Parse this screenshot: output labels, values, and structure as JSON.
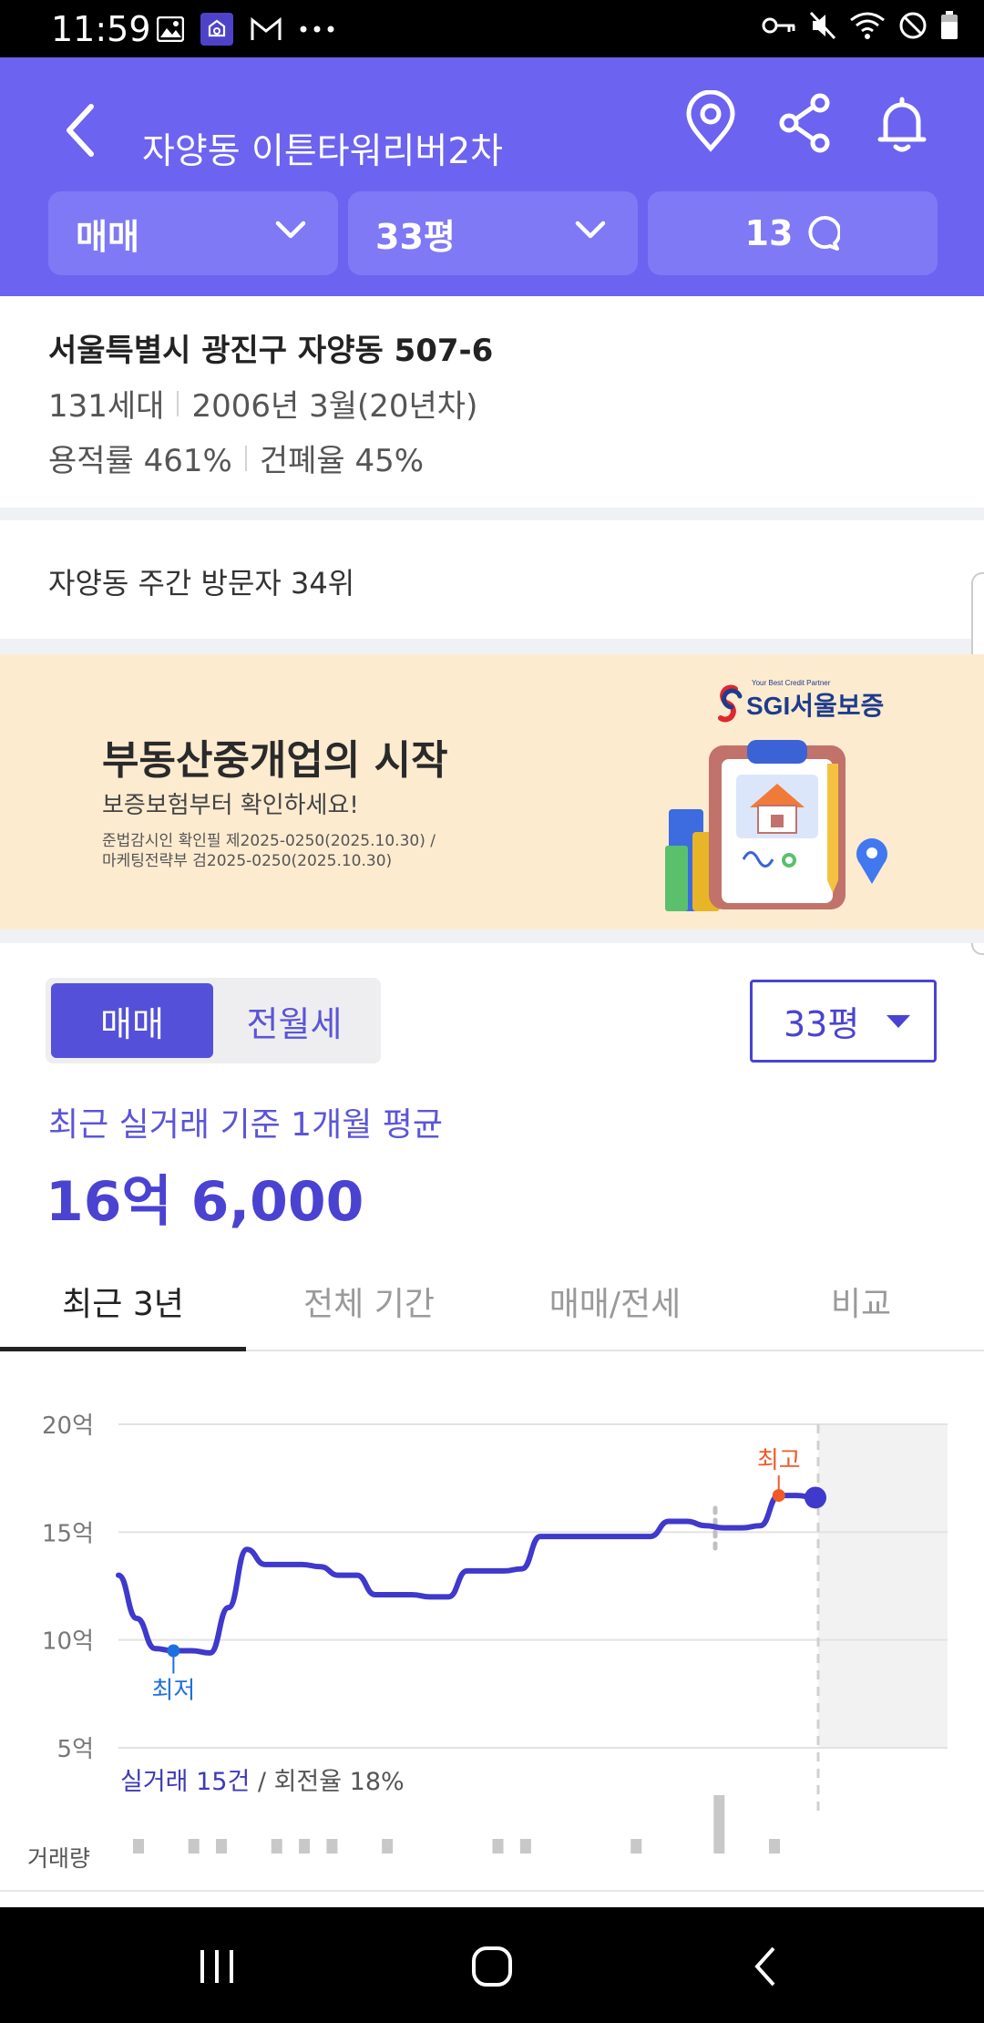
{
  "status": {
    "time": "11:59",
    "left_icons": [
      "image-icon",
      "app-notification-icon",
      "gmail-icon",
      "more-dots-icon"
    ],
    "right_icons": [
      "vpn-key-icon",
      "mute-icon",
      "wifi-icon",
      "do-not-disturb-icon",
      "battery-icon"
    ]
  },
  "header": {
    "title": "자양동 이튼타워리버2차",
    "icons": [
      "location-pin-icon",
      "share-icon",
      "bell-icon"
    ],
    "background": "#6C63F0"
  },
  "filters": {
    "deal_type": "매매",
    "size": "33평",
    "comment_count": "13"
  },
  "complex": {
    "address": "서울특별시 광진구 자양동 507-6",
    "households": "131세대",
    "built": "2006년 3월(20년차)",
    "far": "용적률 461%",
    "bcr": "건폐율 45%"
  },
  "visitor_rank": "자양동 주간 방문자 34위",
  "banner": {
    "title": "부동산중개업의 시작",
    "subtitle": "보증보험부터 확인하세요!",
    "fine_print_1": "준법감시인 확인필 제2025-0250(2025.10.30) /",
    "fine_print_2": "마케팅전략부 검2025-0250(2025.10.30)",
    "logo_tagline": "Your Best Credit Partner",
    "logo_text": "SGI서울보증",
    "background": "#FDEBD0"
  },
  "price": {
    "toggle": [
      "매매",
      "전월세"
    ],
    "size_select": "33평",
    "avg_label": "최근 실거래 기준 1개월 평균",
    "avg_value": "16억 6,000",
    "accent": "#4A43D1"
  },
  "tabs": [
    "최근 3년",
    "전체 기간",
    "매매/전세",
    "비교"
  ],
  "chart": {
    "caption_highlight": "실거래 15건",
    "caption_rest": " / 회전율 18%",
    "volume_label": "거래량"
  },
  "chart_data": {
    "type": "line",
    "y_ticks": [
      "20억",
      "15억",
      "10억",
      "5억"
    ],
    "ylim": [
      5,
      20
    ],
    "y_unit": "억",
    "series": [
      {
        "values": [
          13.0,
          11.0,
          9.6,
          9.5,
          9.5,
          9.4,
          11.5,
          14.2,
          13.5,
          13.5,
          13.5,
          13.4,
          13.0,
          13.0,
          12.1,
          12.1,
          12.1,
          12.0,
          12.0,
          13.2,
          13.2,
          13.2,
          13.3,
          14.8,
          14.8,
          14.8,
          14.8,
          14.8,
          14.8,
          14.8,
          15.5,
          15.5,
          15.3,
          15.2,
          15.2,
          15.3,
          16.7,
          16.7,
          16.6
        ]
      }
    ],
    "annotations": [
      {
        "label": "최저",
        "value": 9.5
      },
      {
        "label": "최고",
        "value": 16.7
      }
    ],
    "volume": [
      1,
      0,
      1,
      1,
      0,
      1,
      1,
      1,
      0,
      1,
      0,
      0,
      0,
      1,
      1,
      0,
      0,
      0,
      1,
      0,
      0,
      4,
      0,
      1
    ],
    "colors": {
      "line": "#3F39CC",
      "min": "#1E6FE0",
      "max": "#F05A28",
      "volume": "#C8C8C8"
    }
  }
}
